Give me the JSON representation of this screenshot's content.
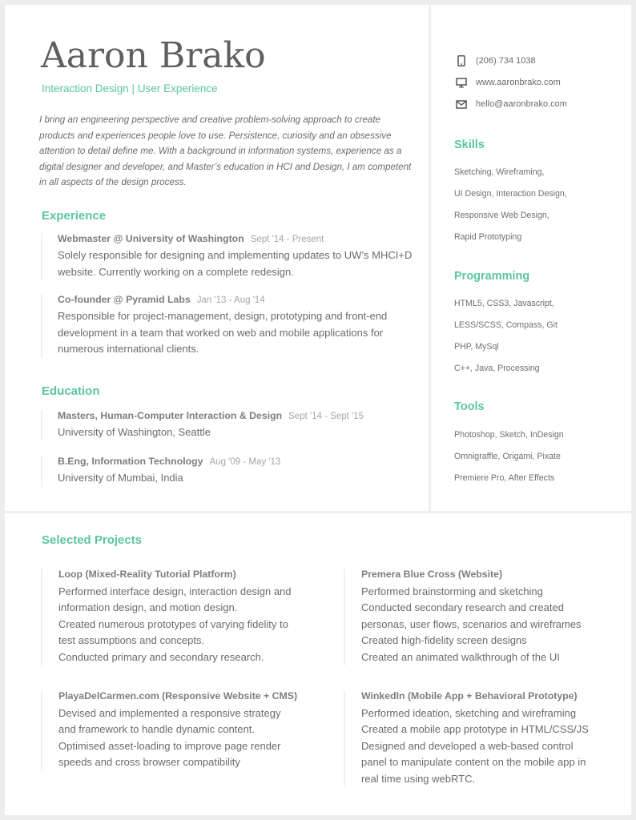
{
  "header": {
    "name": "Aaron Brako",
    "tagline": "Interaction Design | User Experience",
    "summary": "I bring an engineering perspective and creative problem-solving approach to create products and experiences people love to use. Persistence, curiosity and an obsessive attention to detail define me. With a background in information systems, experience as a digital designer and developer, and Master’s education in HCI and Design, I am competent in all aspects of the design process."
  },
  "colors": {
    "accent": "#5cc4a0",
    "text": "#6b6b6b",
    "muted": "#a5a5a5",
    "frame": "#ededed"
  },
  "experience": {
    "title": "Experience",
    "items": [
      {
        "role": "Webmaster @ University of Washington",
        "dates": "Sept '14 - Present",
        "description": "Solely responsible for designing and implementing updates to UW’s MHCI+D website. Currently working on a complete redesign."
      },
      {
        "role": "Co-founder @ Pyramid Labs",
        "dates": "Jan '13 - Aug '14",
        "description": "Responsible for project-management, design, prototyping and front-end development in a team that worked on web and mobile applications for numerous international clients."
      }
    ]
  },
  "education": {
    "title": "Education",
    "items": [
      {
        "degree": "Masters, Human-Computer Interaction & Design",
        "dates": "Sept '14 - Sept '15",
        "school": "University of Washington, Seattle"
      },
      {
        "degree": "B.Eng, Information Technology",
        "dates": "Aug '09 - May '13",
        "school": "University of Mumbai, India"
      }
    ]
  },
  "contact": {
    "phone": {
      "icon": "phone-icon",
      "value": "(206) 734 1038"
    },
    "website": {
      "icon": "monitor-icon",
      "value": "www.aaronbrako.com"
    },
    "email": {
      "icon": "envelope-icon",
      "value": "hello@aaronbrako.com"
    }
  },
  "skills": {
    "title": "Skills",
    "items": [
      "Sketching, Wireframing,",
      "UI Design, Interaction Design,",
      "Responsive Web Design,",
      "Rapid Prototyping"
    ]
  },
  "programming": {
    "title": "Programming",
    "items": [
      "HTML5, CSS3, Javascript,",
      "LESS/SCSS, Compass, Git",
      "PHP, MySql",
      "C++, Java, Processing"
    ]
  },
  "tools": {
    "title": "Tools",
    "items": [
      "Photoshop, Sketch, InDesign",
      "Omnigraffle, Origami, Pixate",
      "Premiere Pro, After Effects"
    ]
  },
  "projects": {
    "title": "Selected Projects",
    "items": [
      {
        "title": "Loop (Mixed-Reality Tutorial Platform)",
        "lines": [
          "Performed interface design, interaction design and",
          "information design, and motion design.",
          "Created numerous prototypes of varying fidelity to",
          "test assumptions and concepts.",
          "Conducted primary and secondary research."
        ]
      },
      {
        "title": "Premera Blue Cross (Website)",
        "lines": [
          "Performed brainstorming and sketching",
          "Conducted secondary research and created",
          "personas, user flows, scenarios and wireframes",
          "Created high-fidelity screen designs",
          "Created an animated walkthrough of the UI"
        ]
      },
      {
        "title": "PlayaDelCarmen.com (Responsive Website + CMS)",
        "lines": [
          "Devised and implemented a responsive strategy",
          "and framework to handle dynamic content.",
          "Optimised asset-loading to improve page render",
          "speeds and cross browser compatibility"
        ]
      },
      {
        "title": "WinkedIn (Mobile App + Behavioral Prototype)",
        "lines": [
          "Performed ideation, sketching and wireframing",
          "Created a mobile app prototype in HTML/CSS/JS",
          "Designed and developed a web-based control",
          "panel to manipulate content on the mobile app in",
          "real time using webRTC."
        ]
      }
    ]
  }
}
